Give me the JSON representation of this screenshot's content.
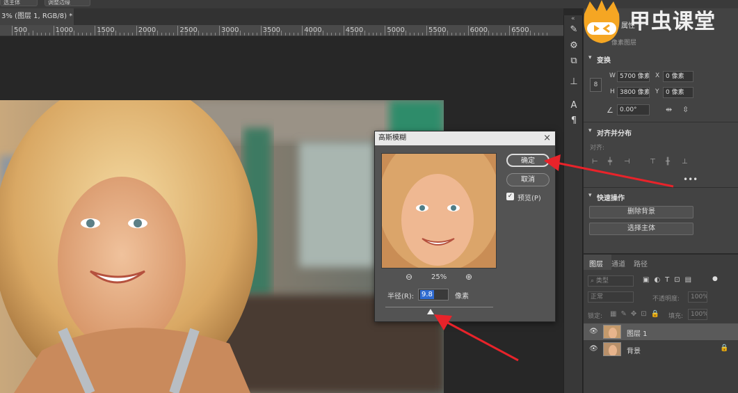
{
  "topbar": {
    "btn1": "选主体",
    "btn2": "调整边缘"
  },
  "document": {
    "tab_title": "3% (图层 1, RGB/8) *"
  },
  "ruler": {
    "labels": [
      "500",
      "1000",
      "1500",
      "2000",
      "2500",
      "3000",
      "3500",
      "4000",
      "4500",
      "5000",
      "5500",
      "6000",
      "6500"
    ]
  },
  "properties": {
    "panel_tab": "属性",
    "panel_sub": "像素图层",
    "transform": {
      "title": "变换",
      "w_label": "W",
      "w_value": "5700 像素",
      "x_label": "X",
      "x_value": "0 像素",
      "h_label": "H",
      "h_value": "3800 像素",
      "y_label": "Y",
      "y_value": "0 像素",
      "angle_value": "0.00°"
    },
    "align": {
      "title": "对齐并分布",
      "sub": "对齐:"
    },
    "quick": {
      "title": "快速操作",
      "remove_bg": "删除背景",
      "select_subject": "选择主体"
    }
  },
  "layers": {
    "tabs": [
      "图层",
      "通道",
      "路径"
    ],
    "filter_placeholder": "类型",
    "blend_mode": "正常",
    "opacity_label": "不透明度:",
    "opacity_value": "100%",
    "lock_label": "锁定:",
    "fill_label": "填充:",
    "fill_value": "100%",
    "items": [
      {
        "name": "图层 1"
      },
      {
        "name": "背景"
      }
    ]
  },
  "dialog": {
    "title": "高斯模糊",
    "ok": "确定",
    "cancel": "取消",
    "preview_label": "预览(P)",
    "zoom_value": "25%",
    "radius_label": "半径(R):",
    "radius_value": "9.8",
    "unit": "像素",
    "slider_fraction": 0.42
  },
  "watermark": {
    "text": "甲虫课堂"
  },
  "colors": {
    "accent_red": "#e8232a",
    "panel": "#434343",
    "dialog": "#535353",
    "selection": "#2f6bd1"
  }
}
